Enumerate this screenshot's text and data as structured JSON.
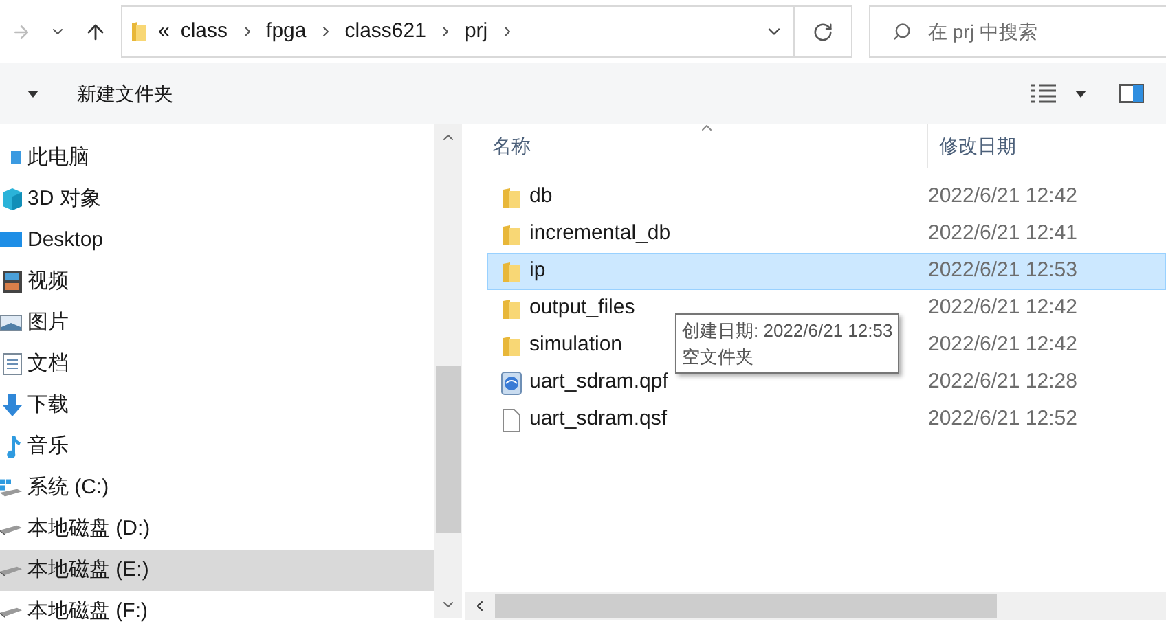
{
  "address_bar": {
    "breadcrumbs": [
      "«",
      "class",
      "fpga",
      "class621",
      "prj"
    ]
  },
  "search": {
    "placeholder": "在 prj 中搜索"
  },
  "toolbar": {
    "new_folder": "新建文件夹"
  },
  "sidebar": {
    "items": [
      {
        "label": "此电脑",
        "kind": "pc",
        "selected": false
      },
      {
        "label": "3D 对象",
        "kind": "cube",
        "selected": false
      },
      {
        "label": "Desktop",
        "kind": "desktop",
        "selected": false
      },
      {
        "label": "视频",
        "kind": "video",
        "selected": false
      },
      {
        "label": "图片",
        "kind": "pictures",
        "selected": false
      },
      {
        "label": "文档",
        "kind": "documents",
        "selected": false
      },
      {
        "label": "下载",
        "kind": "downloads",
        "selected": false
      },
      {
        "label": "音乐",
        "kind": "music",
        "selected": false
      },
      {
        "label": "系统 (C:)",
        "kind": "system_drive",
        "selected": false
      },
      {
        "label": "本地磁盘 (D:)",
        "kind": "drive",
        "selected": false
      },
      {
        "label": "本地磁盘 (E:)",
        "kind": "drive",
        "selected": true
      },
      {
        "label": "本地磁盘 (F:)",
        "kind": "drive",
        "selected": false
      }
    ]
  },
  "file_list": {
    "columns": [
      "名称",
      "修改日期"
    ],
    "rows": [
      {
        "name": "db",
        "modified": "2022/6/21 12:42",
        "kind": "folder",
        "selected": false
      },
      {
        "name": "incremental_db",
        "modified": "2022/6/21 12:41",
        "kind": "folder",
        "selected": false
      },
      {
        "name": "ip",
        "modified": "2022/6/21 12:53",
        "kind": "folder",
        "selected": true
      },
      {
        "name": "output_files",
        "modified": "2022/6/21 12:42",
        "kind": "folder",
        "selected": false
      },
      {
        "name": "simulation",
        "modified": "2022/6/21 12:42",
        "kind": "folder",
        "selected": false
      },
      {
        "name": "uart_sdram.qpf",
        "modified": "2022/6/21 12:28",
        "kind": "project",
        "selected": false
      },
      {
        "name": "uart_sdram.qsf",
        "modified": "2022/6/21 12:52",
        "kind": "file",
        "selected": false
      }
    ]
  },
  "tooltip": {
    "lines": [
      "创建日期: 2022/6/21 12:53",
      "空文件夹"
    ]
  }
}
